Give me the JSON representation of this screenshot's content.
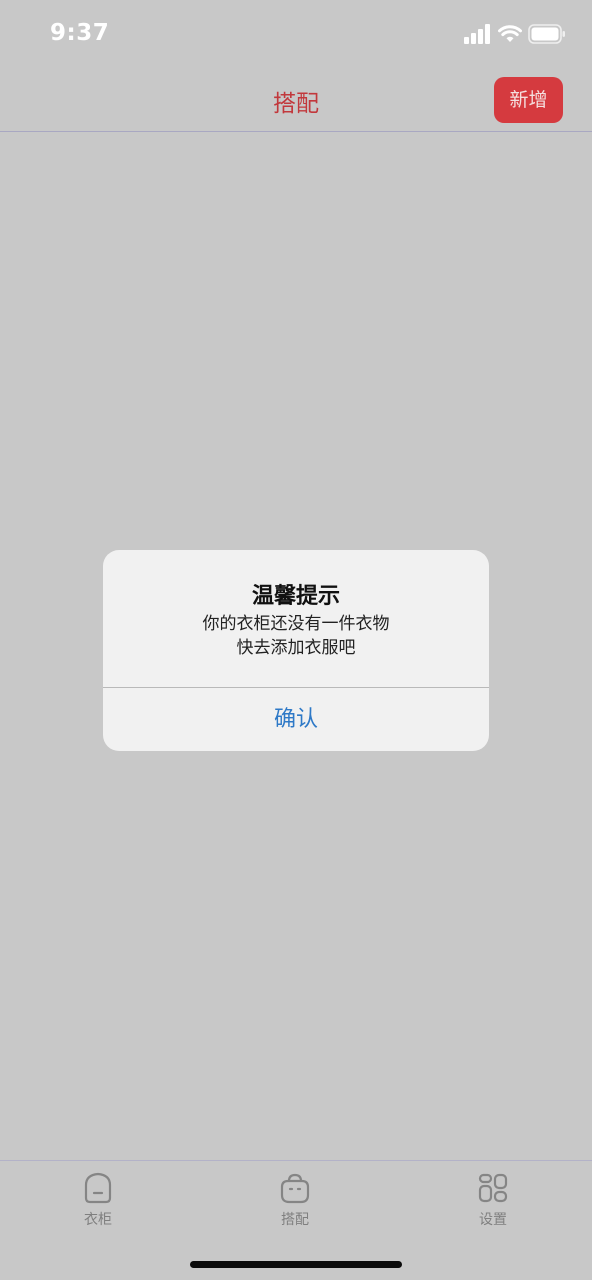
{
  "status_bar": {
    "time": "9:37",
    "icons": [
      "cellular-signal-icon",
      "wifi-icon",
      "battery-icon"
    ]
  },
  "nav": {
    "title": "搭配",
    "add_label": "新增"
  },
  "alert": {
    "title": "温馨提示",
    "message_line1": "你的衣柜还没有一件衣物",
    "message_line2": "快去添加衣服吧",
    "confirm_label": "确认"
  },
  "tabs": [
    {
      "label": "衣柜",
      "icon": "wardrobe-icon"
    },
    {
      "label": "搭配",
      "icon": "bag-icon"
    },
    {
      "label": "设置",
      "icon": "settings-icon"
    }
  ],
  "colors": {
    "background": "#c8c8c8",
    "accent": "#d53a3f",
    "title_red": "#c2383c",
    "link_blue": "#2e79c7",
    "tab_gray": "#7f7f7f"
  }
}
